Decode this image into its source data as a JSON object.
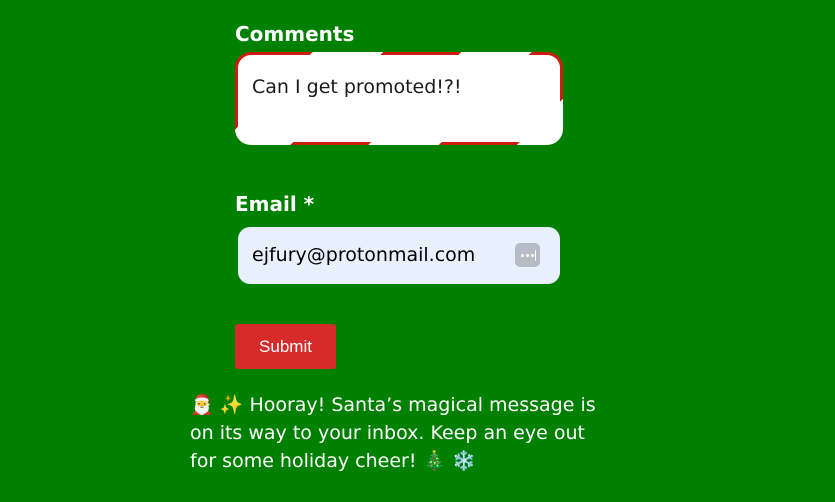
{
  "form": {
    "comments_label": "Comments",
    "comments_value": "Can I get promoted!?!",
    "email_label": "Email *",
    "email_value": "ejfury@protonmail.com",
    "submit_label": "Submit"
  },
  "message": {
    "emoji_start_1": "🎅",
    "emoji_start_2": "✨",
    "text": "Hooray! Santa’s magical message is on its way to your inbox. Keep an eye out for some holiday cheer!",
    "emoji_end_1": "🎄",
    "emoji_end_2": "❄️"
  },
  "colors": {
    "background": "#008000",
    "submit": "#d52b2b",
    "comments_border_red": "#cc1d0e",
    "email_field_bg": "#e8f0fe"
  },
  "icons": {
    "email_autofill": "password-manager-dots-icon"
  }
}
